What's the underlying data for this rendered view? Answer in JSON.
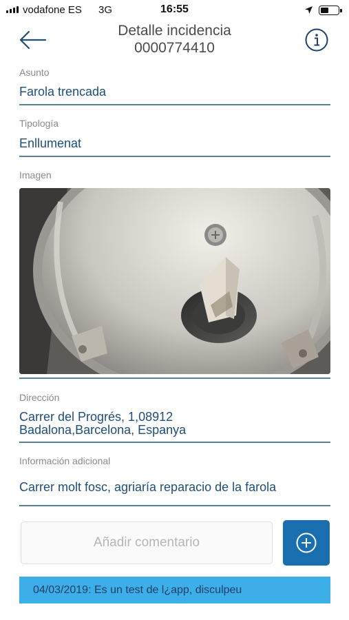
{
  "status_bar": {
    "carrier": "vodafone ES",
    "network": "3G",
    "time": "16:55",
    "icons": [
      "signal-bars-icon",
      "location-arrow-icon",
      "battery-icon"
    ]
  },
  "header": {
    "title_line1": "Detalle incidencia",
    "title_line2": "0000774410",
    "back_icon": "back-arrow-icon",
    "info_icon": "info-icon"
  },
  "fields": {
    "asunto": {
      "label": "Asunto",
      "value": "Farola trencada"
    },
    "tipologia": {
      "label": "Tipología",
      "value": "Enllumenat"
    },
    "imagen": {
      "label": "Imagen"
    },
    "direccion": {
      "label": "Dirección",
      "value_line1": "Carrer del Progrés, 1,08912",
      "value_line2": "Badalona,Barcelona, Espanya"
    },
    "informacion": {
      "label": "Información adicional",
      "value": "Carrer molt fosc, agriaría reparacio de la farola"
    }
  },
  "comment": {
    "placeholder": "Añadir comentario",
    "add_icon": "plus-circle-icon"
  },
  "comments": [
    {
      "text": "04/03/2019: Es un test de l¿app, disculpeu"
    }
  ],
  "colors": {
    "value_text": "#1f4d7a",
    "rule": "#567f9c",
    "label_text": "#8a8a8a",
    "add_button": "#1a6fb0",
    "comment_bg": "#3caee8"
  }
}
